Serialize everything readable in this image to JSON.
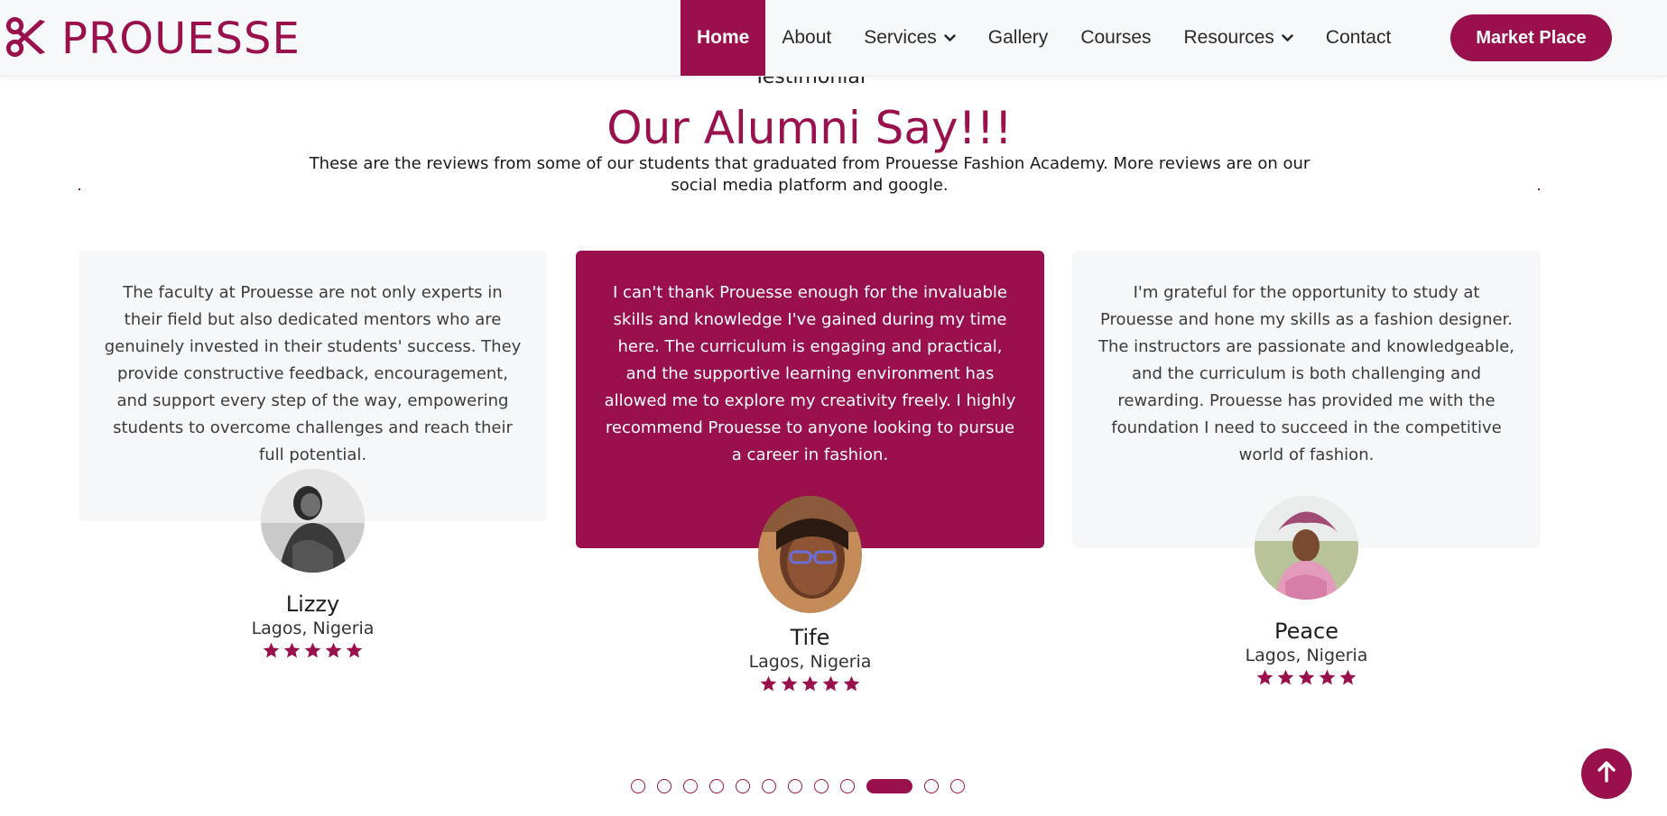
{
  "brand": {
    "name": "PROUESSE",
    "logo_icon": "scissors-icon"
  },
  "nav": {
    "items": [
      {
        "label": "Home",
        "active": true,
        "dropdown": false
      },
      {
        "label": "About",
        "active": false,
        "dropdown": false
      },
      {
        "label": "Services",
        "active": false,
        "dropdown": true
      },
      {
        "label": "Gallery",
        "active": false,
        "dropdown": false
      },
      {
        "label": "Courses",
        "active": false,
        "dropdown": false
      },
      {
        "label": "Resources",
        "active": false,
        "dropdown": true
      },
      {
        "label": "Contact",
        "active": false,
        "dropdown": false
      }
    ],
    "cta_label": "Market Place"
  },
  "section": {
    "label": "Testimonial",
    "title": "Our Alumni Say!!!",
    "subtitle": "These are the reviews from some of our students that graduated from Prouesse Fashion Academy. More reviews are on our social media platform and google."
  },
  "testimonials": [
    {
      "text": "The faculty at Prouesse are not only experts in their field but also dedicated mentors who are genuinely invested in their students' success. They provide constructive feedback, encouragement, and support every step of the way, empowering students to overcome challenges and reach their full potential.",
      "name": "Lizzy",
      "location": "Lagos, Nigeria",
      "rating": 5,
      "highlighted": false
    },
    {
      "text": "I can't thank Prouesse enough for the invaluable skills and knowledge I've gained during my time here. The curriculum is engaging and practical, and the supportive learning environment has allowed me to explore my creativity freely. I highly recommend Prouesse to anyone looking to pursue a career in fashion.",
      "name": "Tife",
      "location": "Lagos, Nigeria",
      "rating": 5,
      "highlighted": true
    },
    {
      "text": "I'm grateful for the opportunity to study at Prouesse and hone my skills as a fashion designer. The instructors are passionate and knowledgeable, and the curriculum is both challenging and rewarding. Prouesse has provided me with the foundation I need to succeed in the competitive world of fashion.",
      "name": "Peace",
      "location": "Lagos, Nigeria",
      "rating": 5,
      "highlighted": false
    }
  ],
  "pagination": {
    "total": 12,
    "active_index": 9
  },
  "colors": {
    "accent": "#99104d",
    "card_light": "#f6f7f9"
  },
  "icons": {
    "scroll_top": "arrow-up-icon",
    "star": "star-icon",
    "chevron": "chevron-down-icon"
  }
}
